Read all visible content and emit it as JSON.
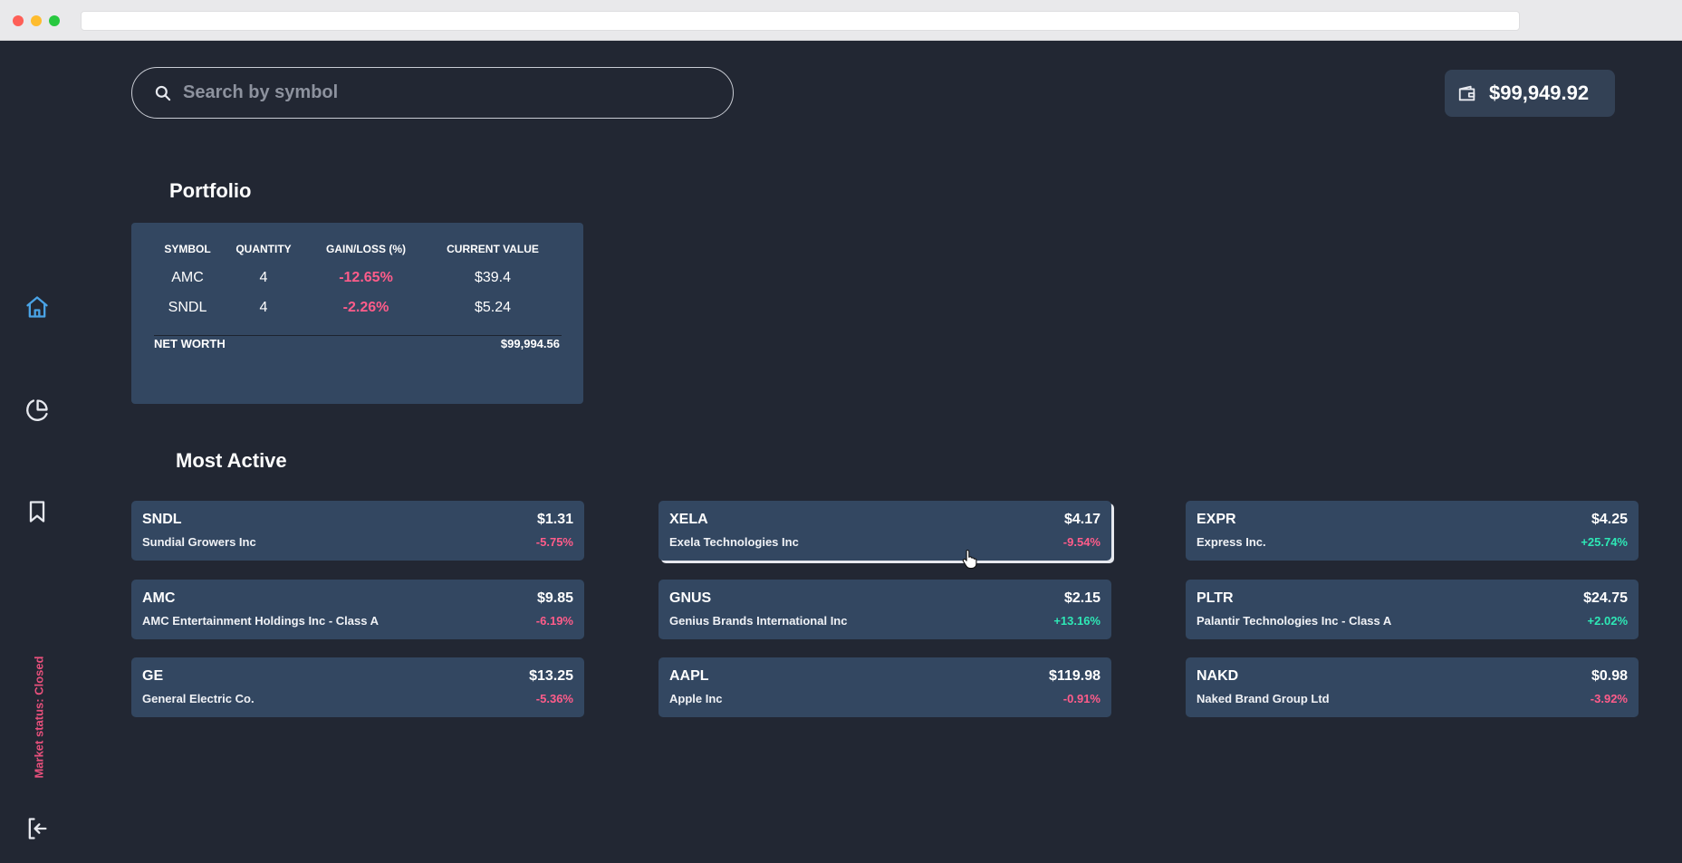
{
  "search": {
    "placeholder": "Search by symbol"
  },
  "wallet": {
    "balance": "$99,949.92"
  },
  "sidebar": {
    "items": [
      {
        "icon": "home-icon",
        "active": true
      },
      {
        "icon": "pie-chart-icon",
        "active": false
      },
      {
        "icon": "bookmark-icon",
        "active": false
      }
    ],
    "market_status": "Market status: Closed",
    "logout_icon": "logout-icon"
  },
  "portfolio": {
    "title": "Portfolio",
    "headers": [
      "SYMBOL",
      "QUANTITY",
      "GAIN/LOSS (%)",
      "CURRENT VALUE"
    ],
    "rows": [
      {
        "symbol": "AMC",
        "quantity": "4",
        "gain_loss": "-12.65%",
        "current_value": "$39.4"
      },
      {
        "symbol": "SNDL",
        "quantity": "4",
        "gain_loss": "-2.26%",
        "current_value": "$5.24"
      }
    ],
    "net_worth_label": "NET WORTH",
    "net_worth_value": "$99,994.56"
  },
  "most_active": {
    "title": "Most Active",
    "stocks": [
      {
        "symbol": "SNDL",
        "name": "Sundial Growers Inc",
        "price": "$1.31",
        "change": "-5.75%",
        "direction": "down"
      },
      {
        "symbol": "XELA",
        "name": "Exela Technologies Inc",
        "price": "$4.17",
        "change": "-9.54%",
        "direction": "down"
      },
      {
        "symbol": "EXPR",
        "name": "Express Inc.",
        "price": "$4.25",
        "change": "+25.74%",
        "direction": "up"
      },
      {
        "symbol": "AMC",
        "name": "AMC Entertainment Holdings Inc - Class A",
        "price": "$9.85",
        "change": "-6.19%",
        "direction": "down"
      },
      {
        "symbol": "GNUS",
        "name": "Genius Brands International Inc",
        "price": "$2.15",
        "change": "+13.16%",
        "direction": "up"
      },
      {
        "symbol": "PLTR",
        "name": "Palantir Technologies Inc - Class A",
        "price": "$24.75",
        "change": "+2.02%",
        "direction": "up"
      },
      {
        "symbol": "GE",
        "name": "General Electric Co.",
        "price": "$13.25",
        "change": "-5.36%",
        "direction": "down"
      },
      {
        "symbol": "AAPL",
        "name": "Apple Inc",
        "price": "$119.98",
        "change": "-0.91%",
        "direction": "down"
      },
      {
        "symbol": "NAKD",
        "name": "Naked Brand Group Ltd",
        "price": "$0.98",
        "change": "-3.92%",
        "direction": "down"
      }
    ]
  },
  "colors": {
    "background": "#222733",
    "card": "#334761",
    "accent": "#4aa3e6",
    "loss": "#ff5c8a",
    "gain": "#2ee8b6",
    "market_closed": "#e8507c"
  }
}
